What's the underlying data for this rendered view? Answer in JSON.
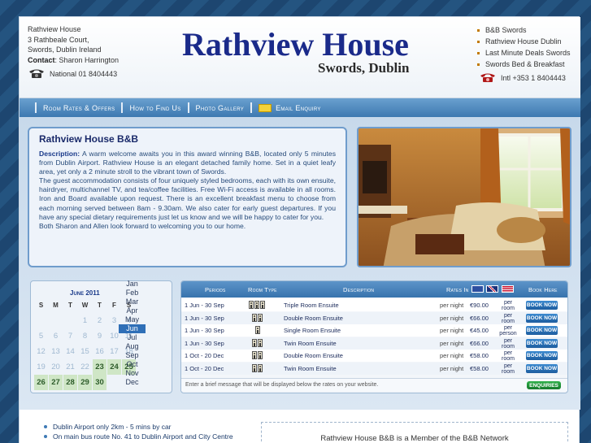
{
  "header": {
    "address_lines": [
      "Rathview House",
      "3 Rathbeale Court,",
      "Swords, Dublin Ireland"
    ],
    "contact_label": "Contact",
    "contact_name": ": Sharon Harrington",
    "phone_national": "National 01 8404443",
    "site_title": "Rathview House",
    "site_subtitle": "Swords, Dublin",
    "right_links": [
      "B&B Swords",
      "Rathview House Dublin",
      "Last Minute Deals Swords",
      "Swords Bed & Breakfast"
    ],
    "phone_intl": "Intl +353 1 8404443"
  },
  "nav": {
    "items": [
      "Room Rates & Offers",
      "How to Find Us",
      "Photo Gallery",
      "Email Enquiry"
    ]
  },
  "intro": {
    "title": "Rathview House B&B",
    "description_label": "Description:",
    "description": " A warm welcome awaits you in this award winning B&B, located only 5 minutes from Dublin Airport. Rathview House is an elegant detached family home. Set in a quiet leafy area, yet only a 2 minute stroll to the vibrant town of Swords.",
    "paragraph2": "The guest accommodation consists of four uniquely styled bedrooms, each with its own ensuite, hairdryer, multichannel TV, and tea/coffee facilities. Free Wi-Fi access is available in all rooms. Iron and Board available upon request. There is an excellent breakfast menu to choose from each morning served between 8am - 9.30am. We also cater for early guest departures. If you have any special dietary requirements just let us know and we will be happy to cater for you.",
    "paragraph3": "Both Sharon and Allen look forward to welcoming you to our home."
  },
  "calendar": {
    "month_title": "June 2011",
    "day_headers": [
      "S",
      "M",
      "T",
      "W",
      "T",
      "F",
      "S"
    ],
    "weeks": [
      [
        {
          "d": "",
          "s": "off"
        },
        {
          "d": "",
          "s": "off"
        },
        {
          "d": "",
          "s": "off"
        },
        {
          "d": "1",
          "s": "past"
        },
        {
          "d": "2",
          "s": "past"
        },
        {
          "d": "3",
          "s": "past"
        },
        {
          "d": "4",
          "s": "past"
        }
      ],
      [
        {
          "d": "5",
          "s": "past"
        },
        {
          "d": "6",
          "s": "past"
        },
        {
          "d": "7",
          "s": "past"
        },
        {
          "d": "8",
          "s": "past"
        },
        {
          "d": "9",
          "s": "past"
        },
        {
          "d": "10",
          "s": "past"
        },
        {
          "d": "11",
          "s": "past"
        }
      ],
      [
        {
          "d": "12",
          "s": "past"
        },
        {
          "d": "13",
          "s": "past"
        },
        {
          "d": "14",
          "s": "past"
        },
        {
          "d": "15",
          "s": "past"
        },
        {
          "d": "16",
          "s": "past"
        },
        {
          "d": "17",
          "s": "past"
        },
        {
          "d": "18",
          "s": "past"
        }
      ],
      [
        {
          "d": "19",
          "s": "past"
        },
        {
          "d": "20",
          "s": "past"
        },
        {
          "d": "21",
          "s": "past"
        },
        {
          "d": "22",
          "s": "past"
        },
        {
          "d": "23",
          "s": "av"
        },
        {
          "d": "24",
          "s": "av"
        },
        {
          "d": "25",
          "s": "av"
        }
      ],
      [
        {
          "d": "26",
          "s": "av"
        },
        {
          "d": "27",
          "s": "av"
        },
        {
          "d": "28",
          "s": "av"
        },
        {
          "d": "29",
          "s": "av"
        },
        {
          "d": "30",
          "s": "av"
        },
        {
          "d": "",
          "s": "off"
        },
        {
          "d": "",
          "s": "off"
        }
      ]
    ],
    "months": [
      "Jan",
      "Feb",
      "Mar",
      "Apr",
      "May",
      "Jun",
      "Jul",
      "Aug",
      "Sep",
      "Oct",
      "Nov",
      "Dec"
    ],
    "selected_month": "Jun"
  },
  "rates": {
    "headers": {
      "periods": "Periods",
      "room_type": "Room Type",
      "description": "Description",
      "rates_in": "Rates In",
      "book_here": "Book Here"
    },
    "rows": [
      {
        "period": "1 Jun - 30 Sep",
        "people": 3,
        "description": "Triple Room Ensuite",
        "per": "per night",
        "price": "€90.00",
        "unit": [
          "per",
          "room"
        ],
        "book": "BOOK NOW"
      },
      {
        "period": "1 Jun - 30 Sep",
        "people": 2,
        "description": "Double Room Ensuite",
        "per": "per night",
        "price": "€66.00",
        "unit": [
          "per",
          "room"
        ],
        "book": "BOOK NOW"
      },
      {
        "period": "1 Jun - 30 Sep",
        "people": 1,
        "description": "Single Room Ensuite",
        "per": "per night",
        "price": "€45.00",
        "unit": [
          "per",
          "person"
        ],
        "book": "BOOK NOW"
      },
      {
        "period": "1 Jun - 30 Sep",
        "people": 2,
        "description": "Twin Room Ensuite",
        "per": "per night",
        "price": "€66.00",
        "unit": [
          "per",
          "room"
        ],
        "book": "BOOK NOW"
      },
      {
        "period": "1 Oct - 20 Dec",
        "people": 2,
        "description": "Double Room Ensuite",
        "per": "per night",
        "price": "€58.00",
        "unit": [
          "per",
          "room"
        ],
        "book": "BOOK NOW"
      },
      {
        "period": "1 Oct - 20 Dec",
        "people": 2,
        "description": "Twin Room Ensuite",
        "per": "per night",
        "price": "€58.00",
        "unit": [
          "per",
          "room"
        ],
        "book": "BOOK NOW"
      }
    ],
    "note": "Enter a brief message that will be displayed below the rates on your website.",
    "enquiries": "ENQUIRIES"
  },
  "bottom": {
    "bullets": [
      "Dublin Airport only 2km - 5 mins by car",
      "On main bus route No. 41 to Dublin Airport and City Centre"
    ],
    "member_text": "Rathview House B&B is a Member of the B&B Network"
  },
  "colors": {
    "title_blue": "#1a2a8a",
    "nav_blue": "#3d79b1",
    "panel_border": "#6f9ccc",
    "available_green": "#cfe6c6",
    "book_button": "#1d5d9f",
    "enquiries_green": "#167a2b"
  }
}
